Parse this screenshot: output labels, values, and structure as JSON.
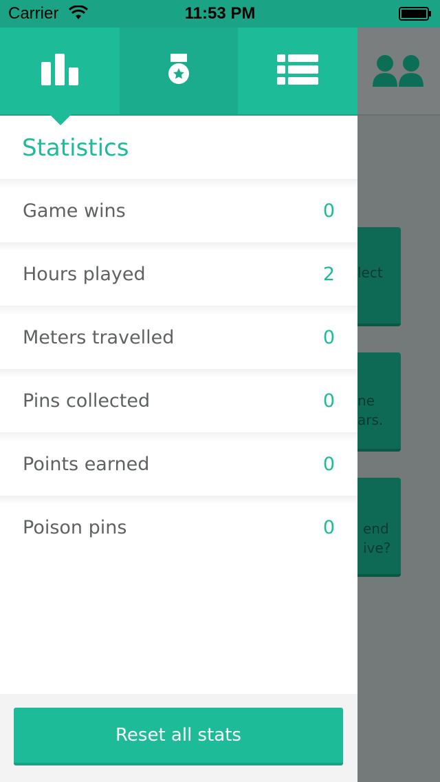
{
  "status_bar": {
    "carrier": "Carrier",
    "time": "11:53 PM",
    "icons": [
      "wifi-icon",
      "battery-icon"
    ]
  },
  "colors": {
    "accent": "#1dbb97",
    "accent_dark": "#1aac8c",
    "text": "#5f6263",
    "overlay": "#747979"
  },
  "drawer": {
    "tabs": [
      {
        "name": "stats",
        "icon": "bar-chart-icon",
        "selected": true
      },
      {
        "name": "awards",
        "icon": "medal-icon",
        "selected": false
      },
      {
        "name": "list",
        "icon": "list-icon",
        "selected": false
      }
    ],
    "title": "Statistics",
    "stats": [
      {
        "label": "Game wins",
        "value": "0"
      },
      {
        "label": "Hours played",
        "value": "2"
      },
      {
        "label": "Meters travelled",
        "value": "0"
      },
      {
        "label": "Pins collected",
        "value": "0"
      },
      {
        "label": "Points earned",
        "value": "0"
      },
      {
        "label": "Poison pins",
        "value": "0"
      }
    ],
    "reset_label": "Reset all stats"
  },
  "background": {
    "header_icon": "friends-icon",
    "cards": [
      {
        "text": "lect"
      },
      {
        "text": "ne\nars."
      },
      {
        "text": "end\nive?"
      }
    ]
  }
}
